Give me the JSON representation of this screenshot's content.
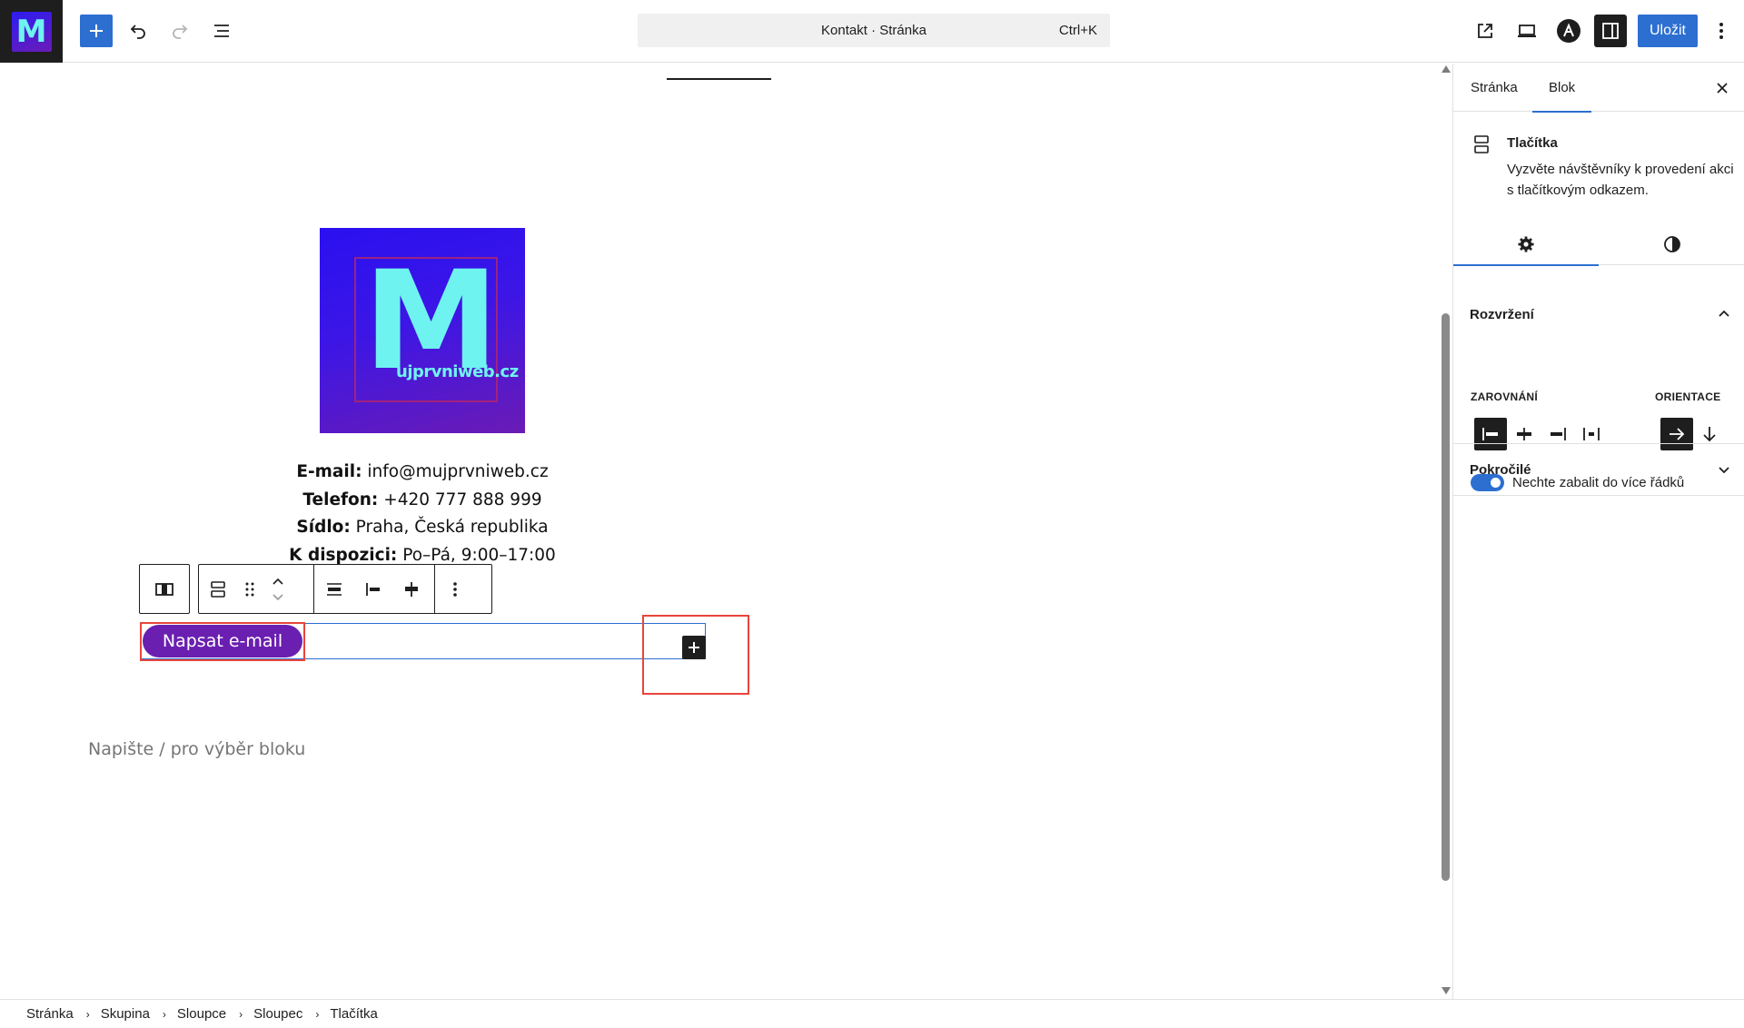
{
  "header": {
    "logo_letter": "M",
    "command_bar": {
      "title": "Kontakt · Stránka",
      "shortcut": "Ctrl+K"
    },
    "save_label": "Uložit"
  },
  "canvas": {
    "logo": {
      "letter": "M",
      "text": "ujprvniweb.cz"
    },
    "contact": [
      {
        "label": "E-mail:",
        "value": "info@mujprvniweb.cz"
      },
      {
        "label": "Telefon:",
        "value": "+420 777 888 999"
      },
      {
        "label": "Sídlo:",
        "value": "Praha, Česká republika"
      },
      {
        "label": "K dispozici:",
        "value": "Po–Pá, 9:00–17:00"
      }
    ],
    "email_button_label": "Napsat e-mail",
    "placeholder": "Napište / pro výběr bloku"
  },
  "sidebar": {
    "tabs": [
      "Stránka",
      "Blok"
    ],
    "active_tab": "Blok",
    "block": {
      "title": "Tlačítka",
      "description": "Vyzvěte návštěvníky k provedení akci s tlačítkovým odkazem."
    },
    "panels": {
      "layout": "Rozvržení",
      "justification_label": "Zarovnání",
      "orientation_label": "Orientace",
      "wrap_label": "Nechte zabalit do více řádků",
      "advanced": "Pokročilé"
    }
  },
  "breadcrumb": [
    "Stránka",
    "Skupina",
    "Sloupce",
    "Sloupec",
    "Tlačítka"
  ],
  "colors": {
    "accent": "#2c6fd1",
    "button": "#6a1fb0",
    "highlight": "#e8453c",
    "dark": "#1e1e1e"
  }
}
